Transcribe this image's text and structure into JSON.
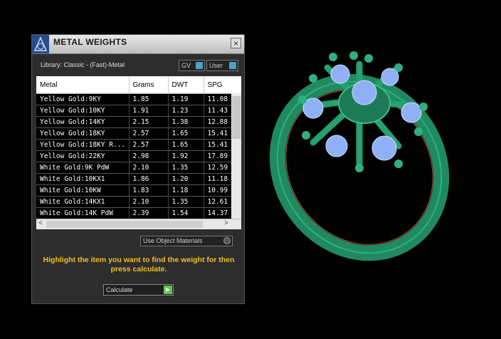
{
  "panel": {
    "title": "METAL WEIGHTS",
    "close_label": "×",
    "library": "Library: Classic - (Fast)-Metal",
    "gv_label": "GV",
    "user_label": "User",
    "columns": [
      "Metal",
      "Grams",
      "DWT",
      "SPG"
    ],
    "rows": [
      [
        "Yellow Gold:9KY",
        "1.85",
        "1.19",
        "11.08"
      ],
      [
        "Yellow Gold:10KY",
        "1.91",
        "1.23",
        "11.43"
      ],
      [
        "Yellow Gold:14KY",
        "2.15",
        "1.38",
        "12.88"
      ],
      [
        "Yellow Gold:18KY",
        "2.57",
        "1.65",
        "15.41"
      ],
      [
        "Yellow Gold:18KY R...",
        "2.57",
        "1.65",
        "15.41"
      ],
      [
        "Yellow Gold:22KY",
        "2.98",
        "1.92",
        "17.89"
      ],
      [
        "White Gold:9K PdW",
        "2.10",
        "1.35",
        "12.59"
      ],
      [
        "White Gold:10KX1",
        "1.86",
        "1.20",
        "11.18"
      ],
      [
        "White Gold:10KW",
        "1.83",
        "1.18",
        "10.99"
      ],
      [
        "White Gold:14KX1",
        "2.10",
        "1.35",
        "12.61"
      ],
      [
        "White Gold:14K PdW",
        "2.39",
        "1.54",
        "14.37"
      ]
    ],
    "use_object_materials": "Use Object Materials",
    "hint": "Highlight the item you want to find the weight for then press calculate.",
    "calculate_label": "Calculate"
  },
  "colors": {
    "accent": "#f0c020",
    "ring": "#1f8a62",
    "gem": "#8fb0f5"
  }
}
